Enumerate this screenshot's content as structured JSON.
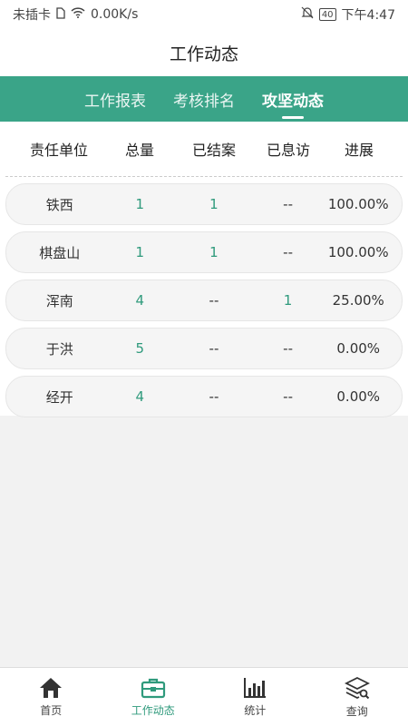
{
  "status_bar": {
    "carrier": "未插卡",
    "speed": "0.00K/s",
    "battery": "40",
    "time": "下午4:47"
  },
  "header": {
    "title": "工作动态"
  },
  "tabs": [
    {
      "label": "工作报表"
    },
    {
      "label": "考核排名"
    },
    {
      "label": "攻坚动态"
    }
  ],
  "table": {
    "columns": [
      "责任单位",
      "总量",
      "已结案",
      "已息访",
      "进展"
    ],
    "rows": [
      {
        "unit": "铁西",
        "total": "1",
        "closed": "1",
        "resolved": "--",
        "progress": "100.00%"
      },
      {
        "unit": "棋盘山",
        "total": "1",
        "closed": "1",
        "resolved": "--",
        "progress": "100.00%"
      },
      {
        "unit": "浑南",
        "total": "4",
        "closed": "--",
        "resolved": "1",
        "progress": "25.00%"
      },
      {
        "unit": "于洪",
        "total": "5",
        "closed": "--",
        "resolved": "--",
        "progress": "0.00%"
      },
      {
        "unit": "经开",
        "total": "4",
        "closed": "--",
        "resolved": "--",
        "progress": "0.00%"
      }
    ]
  },
  "bottom_nav": [
    {
      "label": "首页",
      "icon": "home-icon"
    },
    {
      "label": "工作动态",
      "icon": "briefcase-icon"
    },
    {
      "label": "统计",
      "icon": "bar-chart-icon"
    },
    {
      "label": "查询",
      "icon": "layers-search-icon"
    }
  ],
  "colors": {
    "accent": "#3aa488",
    "accent_text": "#2f9a7c"
  }
}
